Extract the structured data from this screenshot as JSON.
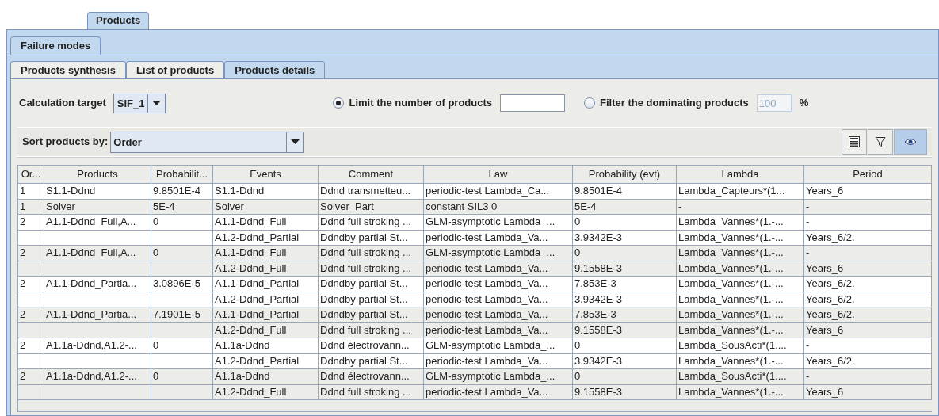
{
  "top_tabs": [
    {
      "label": "Products",
      "selected": true
    }
  ],
  "section_tabs": [
    {
      "label": "Failure modes",
      "selected": true
    }
  ],
  "tabs": [
    {
      "label": "Products synthesis",
      "selected": false
    },
    {
      "label": "List of products",
      "selected": false
    },
    {
      "label": "Products details",
      "selected": true
    }
  ],
  "calculation_target": {
    "label": "Calculation target",
    "value": "SIF_1"
  },
  "limit_option": {
    "label": "Limit the number of products",
    "selected": true
  },
  "filter_option": {
    "label": "Filter the dominating products",
    "selected": false,
    "placeholder": "100",
    "unit": "%"
  },
  "sort": {
    "label": "Sort products by:",
    "value": "Order"
  },
  "toolbar": [
    {
      "kind": "columns",
      "selected": false
    },
    {
      "kind": "filter",
      "selected": false
    },
    {
      "kind": "view",
      "selected": true
    }
  ],
  "table": {
    "columns": [
      "Or...",
      "Products",
      "Probabilit...",
      "Events",
      "Comment",
      "Law",
      "Probability (evt)",
      "Lambda",
      "Period"
    ],
    "rows": [
      {
        "order": "1",
        "product": "S1.1-Ddnd",
        "probability": "9.8501E-4",
        "events": [
          {
            "event": "S1.1-Ddnd",
            "comment": "Ddnd transmetteu...",
            "law": "periodic-test Lambda_Ca...",
            "probability": "9.8501E-4",
            "lambda": "Lambda_Capteurs*(1...",
            "period": "Years_6"
          }
        ]
      },
      {
        "order": "1",
        "product": "Solver",
        "probability": "5E-4",
        "events": [
          {
            "event": "Solver",
            "comment": "Solver_Part",
            "law": "constant SIL3 0",
            "probability": "5E-4",
            "lambda": "-",
            "period": "-"
          }
        ]
      },
      {
        "order": "2",
        "product": "A1.1-Ddnd_Full,A...",
        "probability": "0",
        "events": [
          {
            "event": "A1.1-Ddnd_Full",
            "comment": "Ddnd full stroking ...",
            "law": "GLM-asymptotic Lambda_...",
            "probability": "0",
            "lambda": "Lambda_Vannes*(1.-...",
            "period": "-"
          },
          {
            "event": "A1.2-Ddnd_Partial",
            "comment": "Ddndby partial St...",
            "law": "periodic-test Lambda_Va...",
            "probability": "3.9342E-3",
            "lambda": "Lambda_Vannes*(1.-...",
            "period": "Years_6/2."
          }
        ]
      },
      {
        "order": "2",
        "product": "A1.1-Ddnd_Full,A...",
        "probability": "0",
        "events": [
          {
            "event": "A1.1-Ddnd_Full",
            "comment": "Ddnd full stroking ...",
            "law": "GLM-asymptotic Lambda_...",
            "probability": "0",
            "lambda": "Lambda_Vannes*(1.-...",
            "period": "-"
          },
          {
            "event": "A1.2-Ddnd_Full",
            "comment": "Ddnd full stroking ...",
            "law": "periodic-test Lambda_Va...",
            "probability": "9.1558E-3",
            "lambda": "Lambda_Vannes*(1.-...",
            "period": "Years_6"
          }
        ]
      },
      {
        "order": "2",
        "product": "A1.1-Ddnd_Partia...",
        "probability": "3.0896E-5",
        "events": [
          {
            "event": "A1.1-Ddnd_Partial",
            "comment": "Ddndby partial St...",
            "law": "periodic-test Lambda_Va...",
            "probability": "7.853E-3",
            "lambda": "Lambda_Vannes*(1.-...",
            "period": "Years_6/2."
          },
          {
            "event": "A1.2-Ddnd_Partial",
            "comment": "Ddndby partial St...",
            "law": "periodic-test Lambda_Va...",
            "probability": "3.9342E-3",
            "lambda": "Lambda_Vannes*(1.-...",
            "period": "Years_6/2."
          }
        ]
      },
      {
        "order": "2",
        "product": "A1.1-Ddnd_Partia...",
        "probability": "7.1901E-5",
        "events": [
          {
            "event": "A1.1-Ddnd_Partial",
            "comment": "Ddndby partial St...",
            "law": "periodic-test Lambda_Va...",
            "probability": "7.853E-3",
            "lambda": "Lambda_Vannes*(1.-...",
            "period": "Years_6/2."
          },
          {
            "event": "A1.2-Ddnd_Full",
            "comment": "Ddnd full stroking ...",
            "law": "periodic-test Lambda_Va...",
            "probability": "9.1558E-3",
            "lambda": "Lambda_Vannes*(1.-...",
            "period": "Years_6"
          }
        ]
      },
      {
        "order": "2",
        "product": "A1.1a-Ddnd,A1.2-...",
        "probability": "0",
        "events": [
          {
            "event": "A1.1a-Ddnd",
            "comment": "Ddnd électrovann...",
            "law": "GLM-asymptotic Lambda_...",
            "probability": "0",
            "lambda": "Lambda_SousActi*(1....",
            "period": "-"
          },
          {
            "event": "A1.2-Ddnd_Partial",
            "comment": "Ddndby partial St...",
            "law": "periodic-test Lambda_Va...",
            "probability": "3.9342E-3",
            "lambda": "Lambda_Vannes*(1.-...",
            "period": "Years_6/2."
          }
        ]
      },
      {
        "order": "2",
        "product": "A1.1a-Ddnd,A1.2-...",
        "probability": "0",
        "events": [
          {
            "event": "A1.1a-Ddnd",
            "comment": "Ddnd électrovann...",
            "law": "GLM-asymptotic Lambda_...",
            "probability": "0",
            "lambda": "Lambda_SousActi*(1....",
            "period": "-"
          },
          {
            "event": "A1.2-Ddnd_Full",
            "comment": "Ddnd full stroking ...",
            "law": "periodic-test Lambda_Va...",
            "probability": "9.1558E-3",
            "lambda": "Lambda_Vannes*(1.-...",
            "period": "Years_6"
          }
        ]
      }
    ]
  }
}
